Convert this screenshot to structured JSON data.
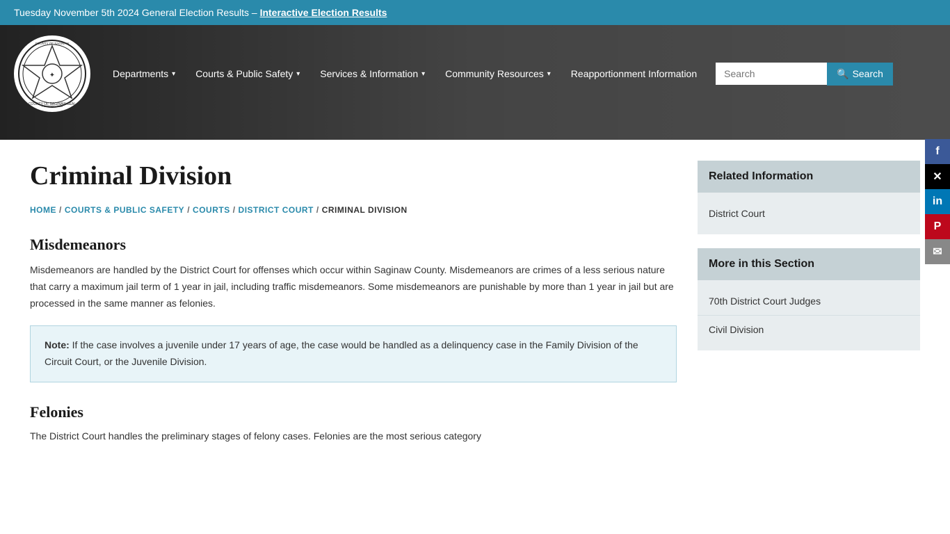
{
  "topBanner": {
    "text": "Tuesday November 5th 2024 General Election Results  –  ",
    "linkText": "Interactive Election Results",
    "linkHref": "#"
  },
  "header": {
    "logoAlt": "County of Saginaw Seal",
    "nav": [
      {
        "id": "departments",
        "label": "Departments",
        "hasDropdown": true
      },
      {
        "id": "courts",
        "label": "Courts & Public Safety",
        "hasDropdown": true
      },
      {
        "id": "services",
        "label": "Services & Information",
        "hasDropdown": true
      },
      {
        "id": "community",
        "label": "Community Resources",
        "hasDropdown": true
      },
      {
        "id": "reapportionment",
        "label": "Reapportionment Information",
        "hasDropdown": false
      }
    ],
    "search": {
      "placeholder": "Search",
      "buttonLabel": "Search"
    }
  },
  "social": [
    {
      "id": "facebook",
      "label": "f",
      "class": "social-fb"
    },
    {
      "id": "twitter",
      "label": "𝕏",
      "class": "social-x"
    },
    {
      "id": "linkedin",
      "label": "in",
      "class": "social-li"
    },
    {
      "id": "pinterest",
      "label": "P",
      "class": "social-pi"
    },
    {
      "id": "email",
      "label": "✉",
      "class": "social-em"
    }
  ],
  "page": {
    "title": "Criminal Division",
    "breadcrumb": [
      {
        "label": "HOME",
        "href": "#",
        "isLink": true
      },
      {
        "label": "COURTS & PUBLIC SAFETY",
        "href": "#",
        "isLink": true
      },
      {
        "label": "COURTS",
        "href": "#",
        "isLink": true
      },
      {
        "label": "DISTRICT COURT",
        "href": "#",
        "isLink": true
      },
      {
        "label": "CRIMINAL DIVISION",
        "isLink": false
      }
    ],
    "sections": [
      {
        "id": "misdemeanors",
        "title": "Misdemeanors",
        "text": "Misdemeanors are handled by the District Court for offenses which occur within Saginaw County. Misdemeanors are crimes of a less serious nature that carry a maximum jail term of 1 year in jail, including traffic misdemeanors. Some misdemeanors are punishable by more than 1 year in jail but are processed in the same manner as felonies."
      }
    ],
    "noteBox": {
      "label": "Note:",
      "text": " If the case involves a juvenile under 17 years of age, the case would be handled as a delinquency case in the Family Division of the Circuit Court, or the Juvenile Division."
    },
    "felonies": {
      "title": "Felonies",
      "text": "The District Court handles the preliminary stages of felony cases. Felonies are the most serious category"
    }
  },
  "sidebar": {
    "relatedInfo": {
      "title": "Related Information",
      "links": [
        {
          "label": "District Court",
          "href": "#"
        }
      ]
    },
    "moreInSection": {
      "title": "More in this Section",
      "links": [
        {
          "label": "70th District Court Judges",
          "href": "#"
        },
        {
          "label": "Civil Division",
          "href": "#"
        }
      ]
    }
  }
}
